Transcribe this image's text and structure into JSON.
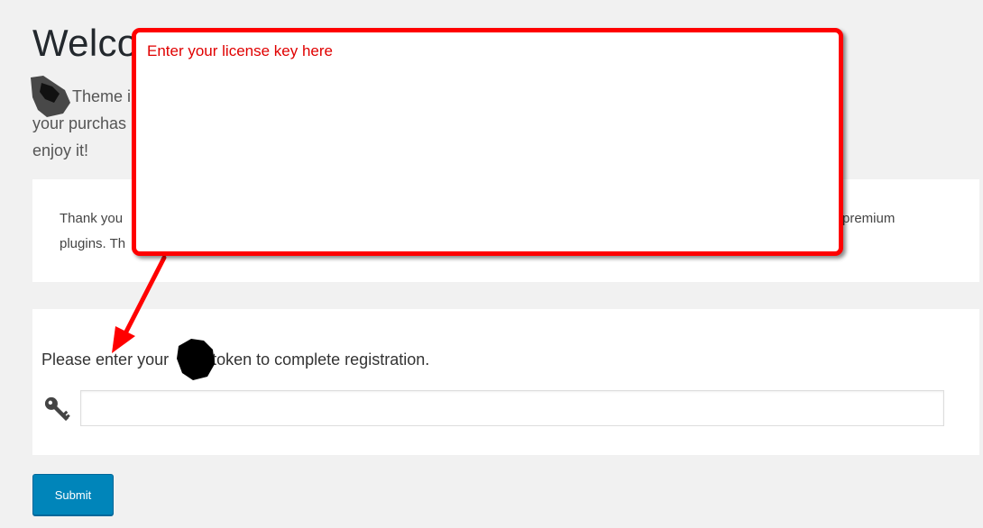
{
  "page": {
    "title": "Welco"
  },
  "intro": {
    "line1": "Theme i",
    "line2": "your purchas",
    "line3": "enjoy it!"
  },
  "thanks_card": {
    "line1_left": "Thank you",
    "line1_right": "premium",
    "line2_left": "plugins. Th"
  },
  "registration": {
    "prompt_before": "Please enter your",
    "prompt_after": "token to complete registration.",
    "token_value": "",
    "token_placeholder": ""
  },
  "submit": {
    "label": "Submit"
  },
  "annotation": {
    "callout_text": "Enter your license key here",
    "accent_color": "#ff0000"
  }
}
